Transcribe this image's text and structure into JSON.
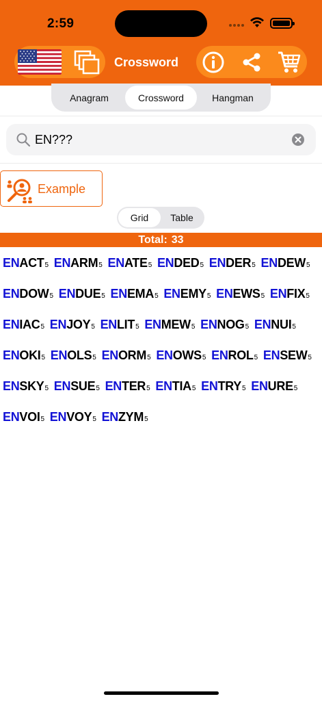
{
  "status_bar": {
    "time": "2:59"
  },
  "header": {
    "title": "Crossword",
    "flag_icon": "us-flag-icon",
    "colors": {
      "primary": "#ef650e",
      "pill": "#fb8a1c",
      "prefix": "#1313d6"
    }
  },
  "modes": [
    {
      "label": "Anagram",
      "active": false
    },
    {
      "label": "Crossword",
      "active": true
    },
    {
      "label": "Hangman",
      "active": false
    }
  ],
  "search": {
    "value": "EN???",
    "placeholder": ""
  },
  "example": {
    "label": "Example"
  },
  "views": [
    {
      "label": "Grid",
      "active": true
    },
    {
      "label": "Table",
      "active": false
    }
  ],
  "total": {
    "label": "Total:",
    "count": "33"
  },
  "results": {
    "prefix": "EN",
    "length_label": "5",
    "suffixes": [
      "ACT",
      "ARM",
      "ATE",
      "DED",
      "DER",
      "DEW",
      "DOW",
      "DUE",
      "EMA",
      "EMY",
      "EWS",
      "FIX",
      "IAC",
      "JOY",
      "LIT",
      "MEW",
      "NOG",
      "NUI",
      "OKI",
      "OLS",
      "ORM",
      "OWS",
      "ROL",
      "SEW",
      "SKY",
      "SUE",
      "TER",
      "TIA",
      "TRY",
      "URE",
      "VOI",
      "VOY",
      "ZYM"
    ]
  }
}
